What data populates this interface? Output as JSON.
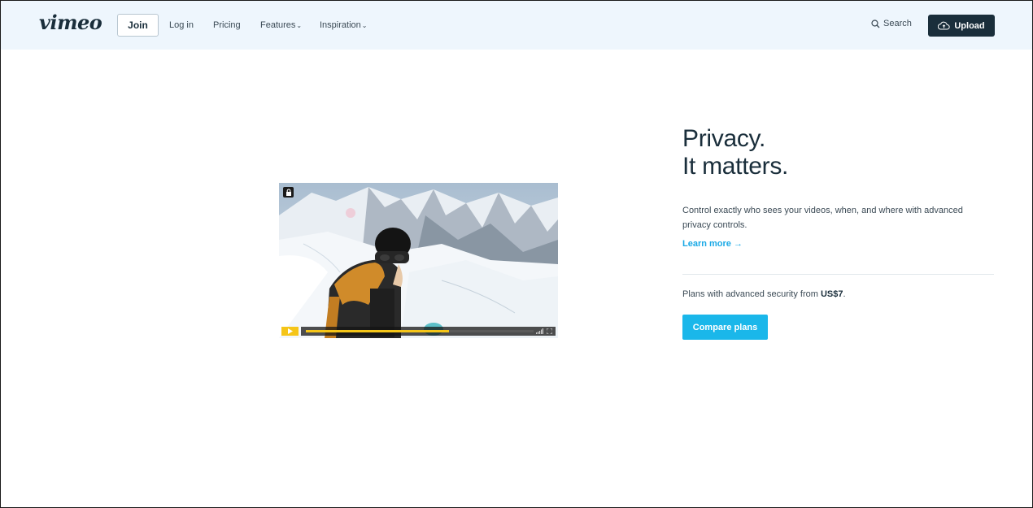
{
  "header": {
    "logo": "vimeo",
    "join_label": "Join",
    "nav": {
      "login": "Log in",
      "pricing": "Pricing",
      "features": "Features",
      "inspiration": "Inspiration"
    },
    "search_label": "Search",
    "upload_label": "Upload"
  },
  "player": {
    "progress": 0.63
  },
  "main": {
    "headline_line1": "Privacy.",
    "headline_line2": "It matters.",
    "description": "Control exactly who sees your videos, when, and where with advanced privacy controls.",
    "learn_more": "Learn more →",
    "plans_prefix": "Plans with advanced security from ",
    "plans_price": "US$7",
    "plans_suffix": ".",
    "compare_label": "Compare plans"
  },
  "colors": {
    "header_bg": "#eef6fd",
    "dark": "#1a2e3b",
    "accent_blue": "#1ab7ea",
    "player_yellow": "#f5c518"
  },
  "icons": [
    "search-icon",
    "upload-cloud-icon",
    "lock-icon",
    "play-icon",
    "volume-icon",
    "fullscreen-icon",
    "chevron-down-icon"
  ]
}
